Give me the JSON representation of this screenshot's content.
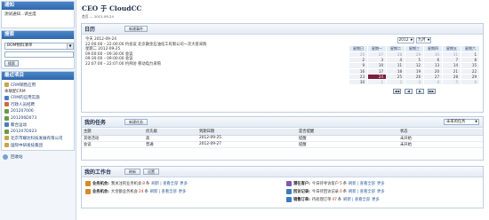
{
  "sidebar": {
    "notice": {
      "title": "通知",
      "text": "测试通知...调主度"
    },
    "search": {
      "title": "搜索",
      "select_value": "BOM物料清单",
      "button": "搜索"
    },
    "recent": {
      "title": "最近项目",
      "group1_label": "CRM销售应用",
      "group2_label": "本联配CRM",
      "items": [
        "CRM销售应用",
        "CRM的应用实施",
        "行政人员招聘",
        "201207006",
        "201206D073",
        "聚合运动",
        "201207D023",
        "北京市耀达科技发展有限公司",
        "国际中研发技集团"
      ]
    },
    "sync": "回收站"
  },
  "main": {
    "title": "CEO 于 CloudCC",
    "subtitle": "首页 — 2012-09-24",
    "schedule": {
      "title": "日历",
      "button": "新建事件",
      "lines": [
        "今天  2012-09-24",
        "  22:00:00 – 22:00:00  约会议 北京融金石油化工有限公司一次大客采购",
        "星期二  2012-09-25",
        "  09:00:00 – 09:30:00  会议",
        "  09:30:00 – 09:00:00  会议",
        "  22:07:00 – 22:07:00  约拜访 移动电力采购"
      ],
      "calendar": {
        "year": "2012",
        "month": "九月",
        "weekdays": [
          "星期日",
          "星期一",
          "星期二",
          "星期三",
          "星期四",
          "星期五",
          "星期六"
        ],
        "weeks": [
          [
            "26",
            "27",
            "28",
            "29",
            "30",
            "31",
            "1"
          ],
          [
            "2",
            "3",
            "4",
            "5",
            "6",
            "7",
            "8"
          ],
          [
            "9",
            "10",
            "11",
            "12",
            "13",
            "14",
            "15"
          ],
          [
            "16",
            "17",
            "18",
            "19",
            "20",
            "21",
            "22"
          ],
          [
            "23",
            "24",
            "25",
            "26",
            "27",
            "28",
            "29"
          ],
          [
            "30",
            "1",
            "2",
            "3",
            "4",
            "5",
            "6"
          ]
        ],
        "today": "24",
        "pager": [
          "◀◀",
          "◀",
          "▶",
          "▶▶"
        ]
      }
    },
    "tasks": {
      "title": "我的任务",
      "button": "新建任务",
      "filter": "未来的任务",
      "columns": [
        "主题",
        "优先级",
        "到期日期",
        "是否提醒",
        "状态"
      ],
      "rows": [
        [
          "其他活动",
          "高",
          "2012-09-25",
          "提醒",
          "未开始"
        ],
        [
          "会议",
          "普通",
          "2012-09-27",
          "提醒",
          "未开始"
        ]
      ]
    },
    "workbench": {
      "title": "我的工作台",
      "buttons": [
        "刷新",
        "设置"
      ],
      "items": [
        {
          "label": "业务机会:",
          "text": "我关注的业务机会",
          "count": "8",
          "unit": "条",
          "link": "刷新 | 查看全部",
          "tag": "更多"
        },
        {
          "label": "业务机会:",
          "text": "大金额业务机会",
          "count": "24",
          "unit": "条",
          "link": "刷新 | 查看全部",
          "tag": "更多"
        },
        {
          "label": "潜在客户:",
          "text": "今日待寻访客户",
          "count": "5",
          "unit": "条",
          "link": "刷新 | 查看全部",
          "tag": "更多"
        },
        {
          "label": "回访记录:",
          "text": "今日待回访记录",
          "count": "0",
          "unit": "条",
          "link": "刷新 | 查看全部",
          "tag": "更多"
        },
        {
          "label": "销售订单:",
          "text": "待处理订单",
          "count": "47",
          "unit": "条",
          "link": "刷新 | 查看全部",
          "tag": "更多"
        }
      ]
    }
  }
}
